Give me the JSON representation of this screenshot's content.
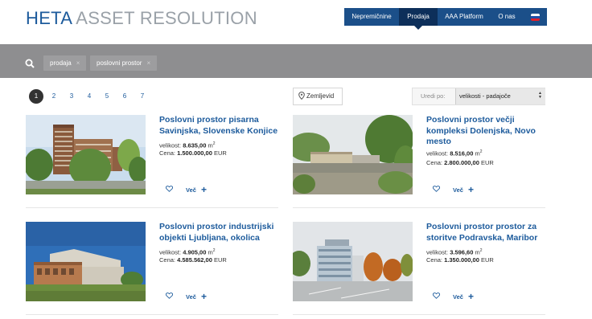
{
  "header": {
    "logo_bold": "HETA",
    "logo_light": "ASSET RESOLUTION",
    "nav": [
      {
        "label": "Nepremičnine",
        "active": false
      },
      {
        "label": "Prodaja",
        "active": true
      },
      {
        "label": "AAA Platform",
        "active": false
      },
      {
        "label": "O nas",
        "active": false
      }
    ],
    "language_flag": "slovenia-flag-icon"
  },
  "filters": {
    "search_icon": "search-icon",
    "chips": [
      {
        "label": "prodaja",
        "remove": "×"
      },
      {
        "label": "poslovni prostor",
        "remove": "×"
      }
    ]
  },
  "pagination": {
    "pages": [
      "1",
      "2",
      "3",
      "4",
      "5",
      "6",
      "7"
    ],
    "current": "1"
  },
  "toolbar": {
    "map_label": "Zemljevid",
    "sort_label": "Uredi po:",
    "sort_value": "velikosti - padajoče"
  },
  "labels": {
    "size": "velikost:",
    "price": "Cena:",
    "more": "Več",
    "plus": "+"
  },
  "listings": [
    {
      "title": "Poslovni prostor pisarna Savinjska, Slovenske Konjice",
      "size": "8.635,00",
      "unit": "m",
      "exp": "2",
      "price": "1.500.000,00",
      "currency": "EUR"
    },
    {
      "title": "Poslovni prostor večji kompleksi Dolenjska, Novo mesto",
      "size": "8.516,00",
      "unit": "m",
      "exp": "2",
      "price": "2.800.000,00",
      "currency": "EUR"
    },
    {
      "title": "Poslovni prostor industrijski objekti Ljubljana, okolica",
      "size": "4.905,00",
      "unit": "m",
      "exp": "2",
      "price": "4.585.562,00",
      "currency": "EUR"
    },
    {
      "title": "Poslovni prostor prostor za storitve Podravska, Maribor",
      "size": "3.596,60",
      "unit": "m",
      "exp": "2",
      "price": "1.350.000,00",
      "currency": "EUR"
    }
  ],
  "colors": {
    "brand_blue": "#1d5b9c",
    "nav_bg": "#1b4f89",
    "nav_active": "#0d2f5a",
    "filter_bar": "#8e8e90"
  }
}
